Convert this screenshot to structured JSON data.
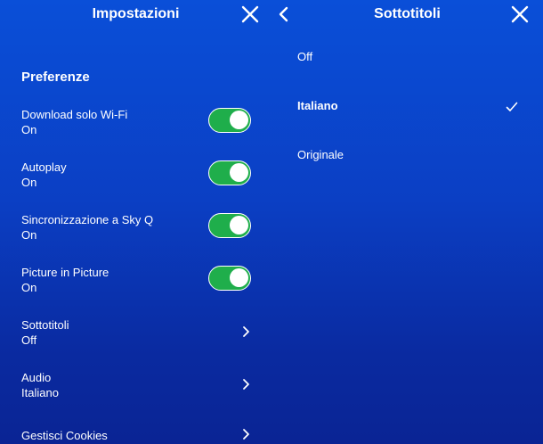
{
  "settings": {
    "title": "Impostazioni",
    "section": "Preferenze",
    "items": [
      {
        "label": "Download solo Wi-Fi",
        "value": "On",
        "control": "toggle",
        "on": true
      },
      {
        "label": "Autoplay",
        "value": "On",
        "control": "toggle",
        "on": true
      },
      {
        "label": "Sincronizzazione a Sky Q",
        "value": "On",
        "control": "toggle",
        "on": true
      },
      {
        "label": "Picture in Picture",
        "value": "On",
        "control": "toggle",
        "on": true
      },
      {
        "label": "Sottotitoli",
        "value": "Off",
        "control": "chevron"
      },
      {
        "label": "Audio",
        "value": "Italiano",
        "control": "chevron"
      },
      {
        "label": "Gestisci Cookies",
        "value": "",
        "control": "chevron"
      }
    ]
  },
  "subtitles": {
    "title": "Sottotitoli",
    "options": [
      {
        "label": "Off",
        "selected": false
      },
      {
        "label": "Italiano",
        "selected": true
      },
      {
        "label": "Originale",
        "selected": false
      }
    ]
  },
  "icons": {
    "close": "close-icon",
    "back": "chevron-left-icon",
    "chevron": "chevron-right-icon",
    "check": "checkmark-icon"
  },
  "colors": {
    "background_top": "#0a4fd8",
    "background_bottom": "#0a2494",
    "toggle_on": "#1fae4b",
    "text": "#ffffff"
  }
}
